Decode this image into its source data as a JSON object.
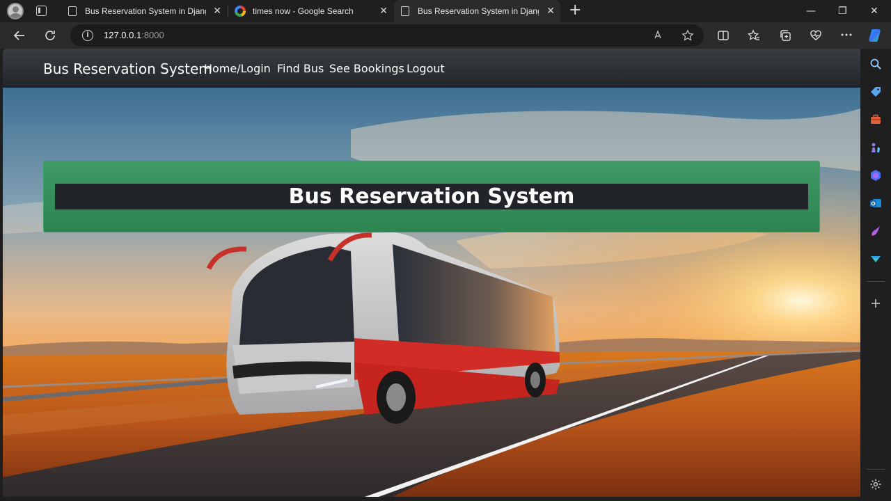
{
  "browser": {
    "tabs": [
      {
        "label": "Bus Reservation System in Django",
        "icon": "page-icon",
        "active": false
      },
      {
        "label": "times now - Google Search",
        "icon": "google-icon",
        "active": false
      },
      {
        "label": "Bus Reservation System in Django",
        "icon": "page-icon",
        "active": true
      }
    ],
    "close_glyph": "✕",
    "new_tab_glyph": "+",
    "address": {
      "host": "127.0.0.1",
      "port": ":8000"
    },
    "window_controls": {
      "minimize": "—",
      "restore": "❐",
      "close": "✕"
    }
  },
  "site": {
    "brand": "Bus Reservation System",
    "nav": [
      "Home/Login",
      "Find Bus",
      "See Bookings",
      "Logout"
    ],
    "hero_title": "Bus Reservation System"
  },
  "colors": {
    "navbar": "#212529",
    "hero_green": "#2e8b57",
    "hero_bar": "#212529"
  }
}
